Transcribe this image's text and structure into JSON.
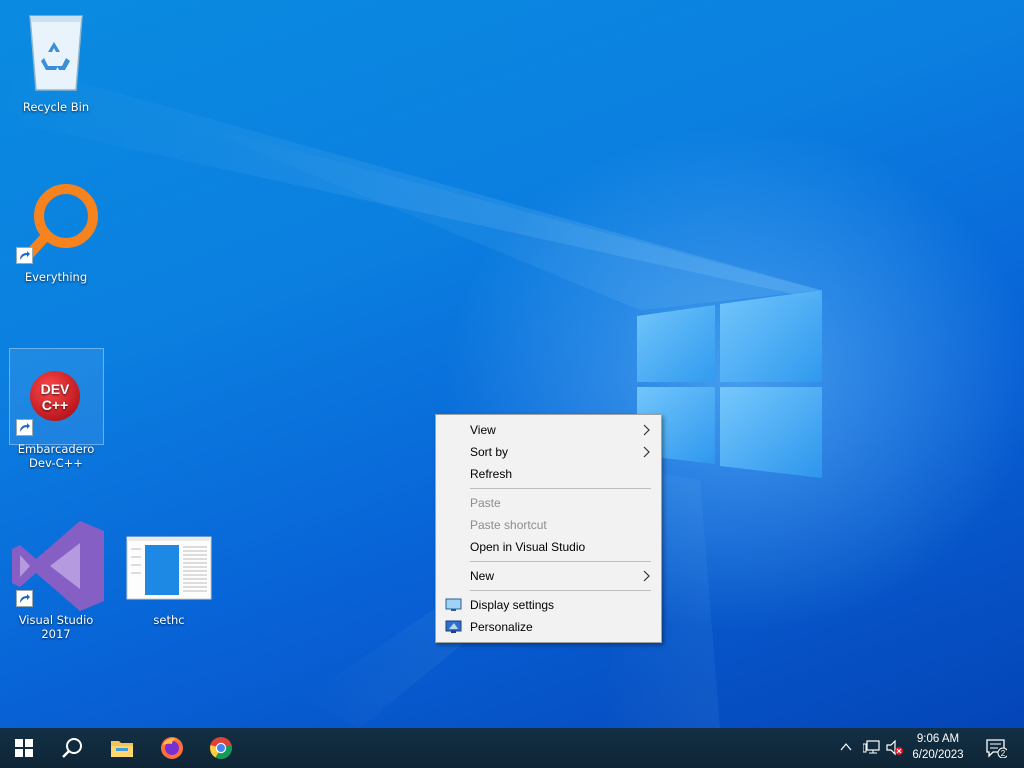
{
  "desktop": {
    "icons": [
      {
        "label": "Recycle Bin",
        "icon": "recycle-bin-icon"
      },
      {
        "label": "Everything",
        "icon": "everything-search-icon"
      },
      {
        "label": "Embarcadero Dev-C++",
        "label_line1": "Embarcadero",
        "label_line2": "Dev-C++",
        "icon": "dev-cpp-icon",
        "badge": "DEV C++"
      },
      {
        "label": "Visual Studio 2017",
        "icon": "visual-studio-icon"
      },
      {
        "label": "sethc",
        "icon": "sethc-thumbnail-icon"
      }
    ]
  },
  "context_menu": {
    "items": [
      {
        "label": "View",
        "submenu": true,
        "enabled": true
      },
      {
        "label": "Sort by",
        "submenu": true,
        "enabled": true
      },
      {
        "label": "Refresh",
        "enabled": true
      },
      {
        "label": "Paste",
        "enabled": false
      },
      {
        "label": "Paste shortcut",
        "enabled": false
      },
      {
        "label": "Open in Visual Studio",
        "enabled": true
      },
      {
        "label": "New",
        "submenu": true,
        "enabled": true
      },
      {
        "label": "Display settings",
        "enabled": true,
        "icon": "display-settings-icon"
      },
      {
        "label": "Personalize",
        "enabled": true,
        "icon": "personalize-icon"
      }
    ]
  },
  "taskbar": {
    "pinned": [
      {
        "name": "start-button",
        "icon": "windows-logo-icon"
      },
      {
        "name": "search-button",
        "icon": "search-icon"
      },
      {
        "name": "file-explorer",
        "icon": "folder-icon"
      },
      {
        "name": "firefox",
        "icon": "firefox-icon"
      },
      {
        "name": "chrome",
        "icon": "chrome-icon"
      }
    ],
    "tray": {
      "time": "9:06 AM",
      "date": "6/20/2023",
      "notification_count": "2"
    }
  },
  "colors": {
    "desktop_accent": "#0b7fe0",
    "taskbar_bg": "#0f2a3d",
    "menu_bg": "#f2f2f2",
    "devcpp_red": "#d81f26",
    "vs_purple": "#865fc5",
    "everything_orange": "#f7831e"
  }
}
